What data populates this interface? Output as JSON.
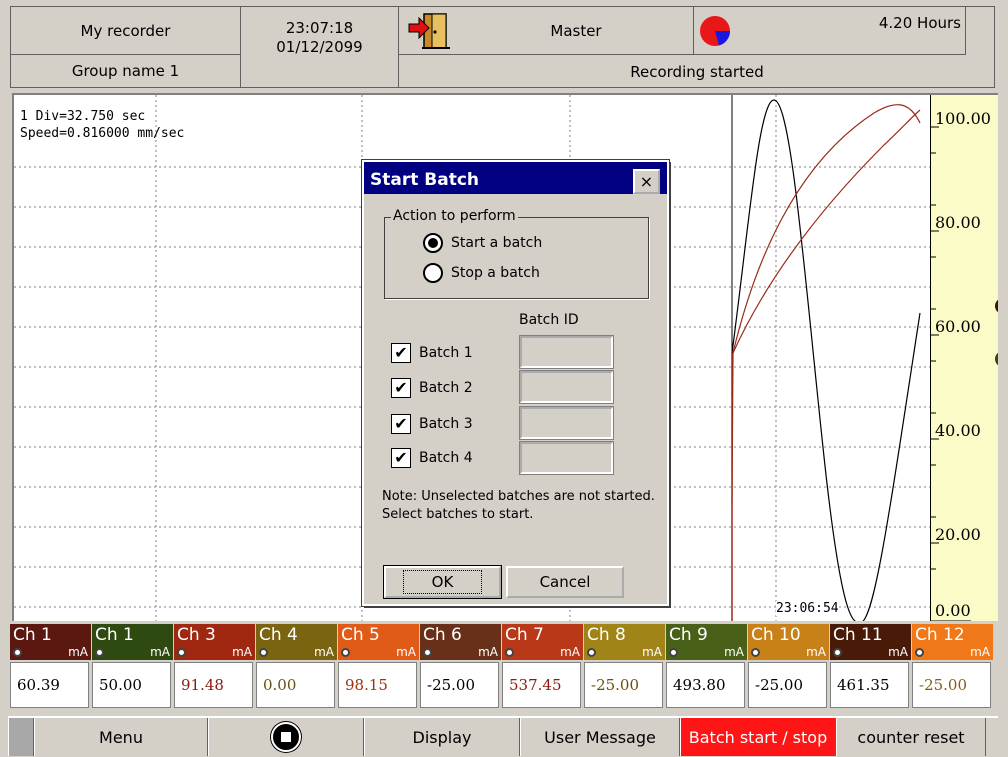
{
  "header": {
    "recorder_name": "My recorder",
    "group_name": "Group name 1",
    "time": "23:07:18",
    "date": "01/12/2099",
    "user": "Master",
    "remaining": "4.20 Hours",
    "status": "Recording started",
    "icons": {
      "logout": "door-exit-icon",
      "disk": "pie-chart-icon"
    }
  },
  "chart": {
    "div_info": "1 Div=32.750 sec",
    "speed_info": "Speed=0.816000 mm/sec",
    "timestamp": "23:06:54",
    "scale_labels": [
      "100.00",
      "80.00",
      "60.00",
      "40.00",
      "20.00",
      "0.00"
    ]
  },
  "dialog": {
    "title": "Start Batch",
    "close_label": "×",
    "group_label": "Action to perform",
    "radio_start": "Start a batch",
    "radio_stop": "Stop a batch",
    "selected_action": "start",
    "batch_id_header": "Batch ID",
    "batches": [
      {
        "label": "Batch 1",
        "checked": true,
        "id": ""
      },
      {
        "label": "Batch 2",
        "checked": true,
        "id": ""
      },
      {
        "label": "Batch 3",
        "checked": true,
        "id": ""
      },
      {
        "label": "Batch 4",
        "checked": true,
        "id": ""
      }
    ],
    "note": "Note: Unselected batches are not started. Select batches to start.",
    "ok_label": "OK",
    "cancel_label": "Cancel"
  },
  "channels": [
    {
      "name": "Ch 1",
      "unit": "mA",
      "value": "60.39",
      "color": "#5a1810",
      "value_color": "#000000"
    },
    {
      "name": "Ch 1",
      "unit": "mA",
      "value": "50.00",
      "color": "#2f4a10",
      "value_color": "#000000"
    },
    {
      "name": "Ch 3",
      "unit": "mA",
      "value": "91.48",
      "color": "#a02810",
      "value_color": "#8b1a10"
    },
    {
      "name": "Ch 4",
      "unit": "mA",
      "value": "0.00",
      "color": "#7a6410",
      "value_color": "#6a5010"
    },
    {
      "name": "Ch 5",
      "unit": "mA",
      "value": "98.15",
      "color": "#e05a18",
      "value_color": "#a03010"
    },
    {
      "name": "Ch 6",
      "unit": "mA",
      "value": "-25.00",
      "color": "#683018",
      "value_color": "#000000"
    },
    {
      "name": "Ch 7",
      "unit": "mA",
      "value": "537.45",
      "color": "#b83818",
      "value_color": "#8b1a10"
    },
    {
      "name": "Ch 8",
      "unit": "mA",
      "value": "-25.00",
      "color": "#a08418",
      "value_color": "#6a5010"
    },
    {
      "name": "Ch 9",
      "unit": "mA",
      "value": "493.80",
      "color": "#486018",
      "value_color": "#000000"
    },
    {
      "name": "Ch 10",
      "unit": "mA",
      "value": "-25.00",
      "color": "#c88018",
      "value_color": "#000000"
    },
    {
      "name": "Ch 11",
      "unit": "mA",
      "value": "461.35",
      "color": "#4a1a08",
      "value_color": "#000000"
    },
    {
      "name": "Ch 12",
      "unit": "mA",
      "value": "-25.00",
      "color": "#f07818",
      "value_color": "#806018"
    }
  ],
  "toolbar": {
    "menu": "Menu",
    "stop_icon": "stop-record-icon",
    "display": "Display",
    "user_message": "User Message",
    "batch": "Batch start / stop",
    "counter_reset": "counter reset",
    "active_color": "#ff1515"
  }
}
